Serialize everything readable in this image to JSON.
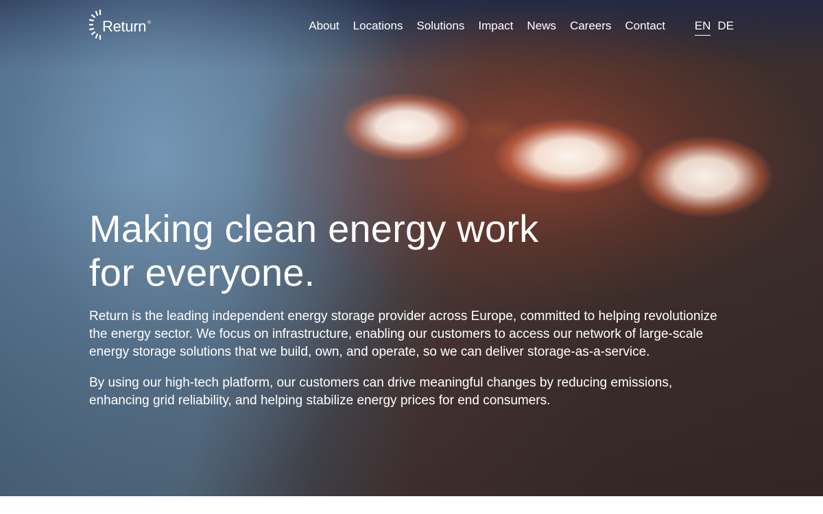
{
  "brand": {
    "name": "Return",
    "registered": "®"
  },
  "nav": {
    "items": [
      {
        "label": "About"
      },
      {
        "label": "Locations"
      },
      {
        "label": "Solutions"
      },
      {
        "label": "Impact"
      },
      {
        "label": "News"
      },
      {
        "label": "Careers"
      },
      {
        "label": "Contact"
      }
    ],
    "languages": [
      {
        "label": "EN",
        "active": true
      },
      {
        "label": "DE",
        "active": false
      }
    ]
  },
  "hero": {
    "headline_line1": "Making clean energy work",
    "headline_line2": "for everyone.",
    "paragraph1": "Return is the leading independent energy storage provider across Europe, committed to helping revolutionize the energy sector. We focus on infrastructure, enabling our customers to access our network of large-scale energy storage solutions that we build, own, and operate, so we can deliver storage-as-a-service.",
    "paragraph2": "By using our high-tech platform, our customers can drive meaningful changes by reducing emissions, enhancing grid reliability, and helping stabilize energy prices for end consumers."
  },
  "colors": {
    "text": "#ffffff",
    "page_background": "#ffffff",
    "glow": "#e8a080"
  }
}
